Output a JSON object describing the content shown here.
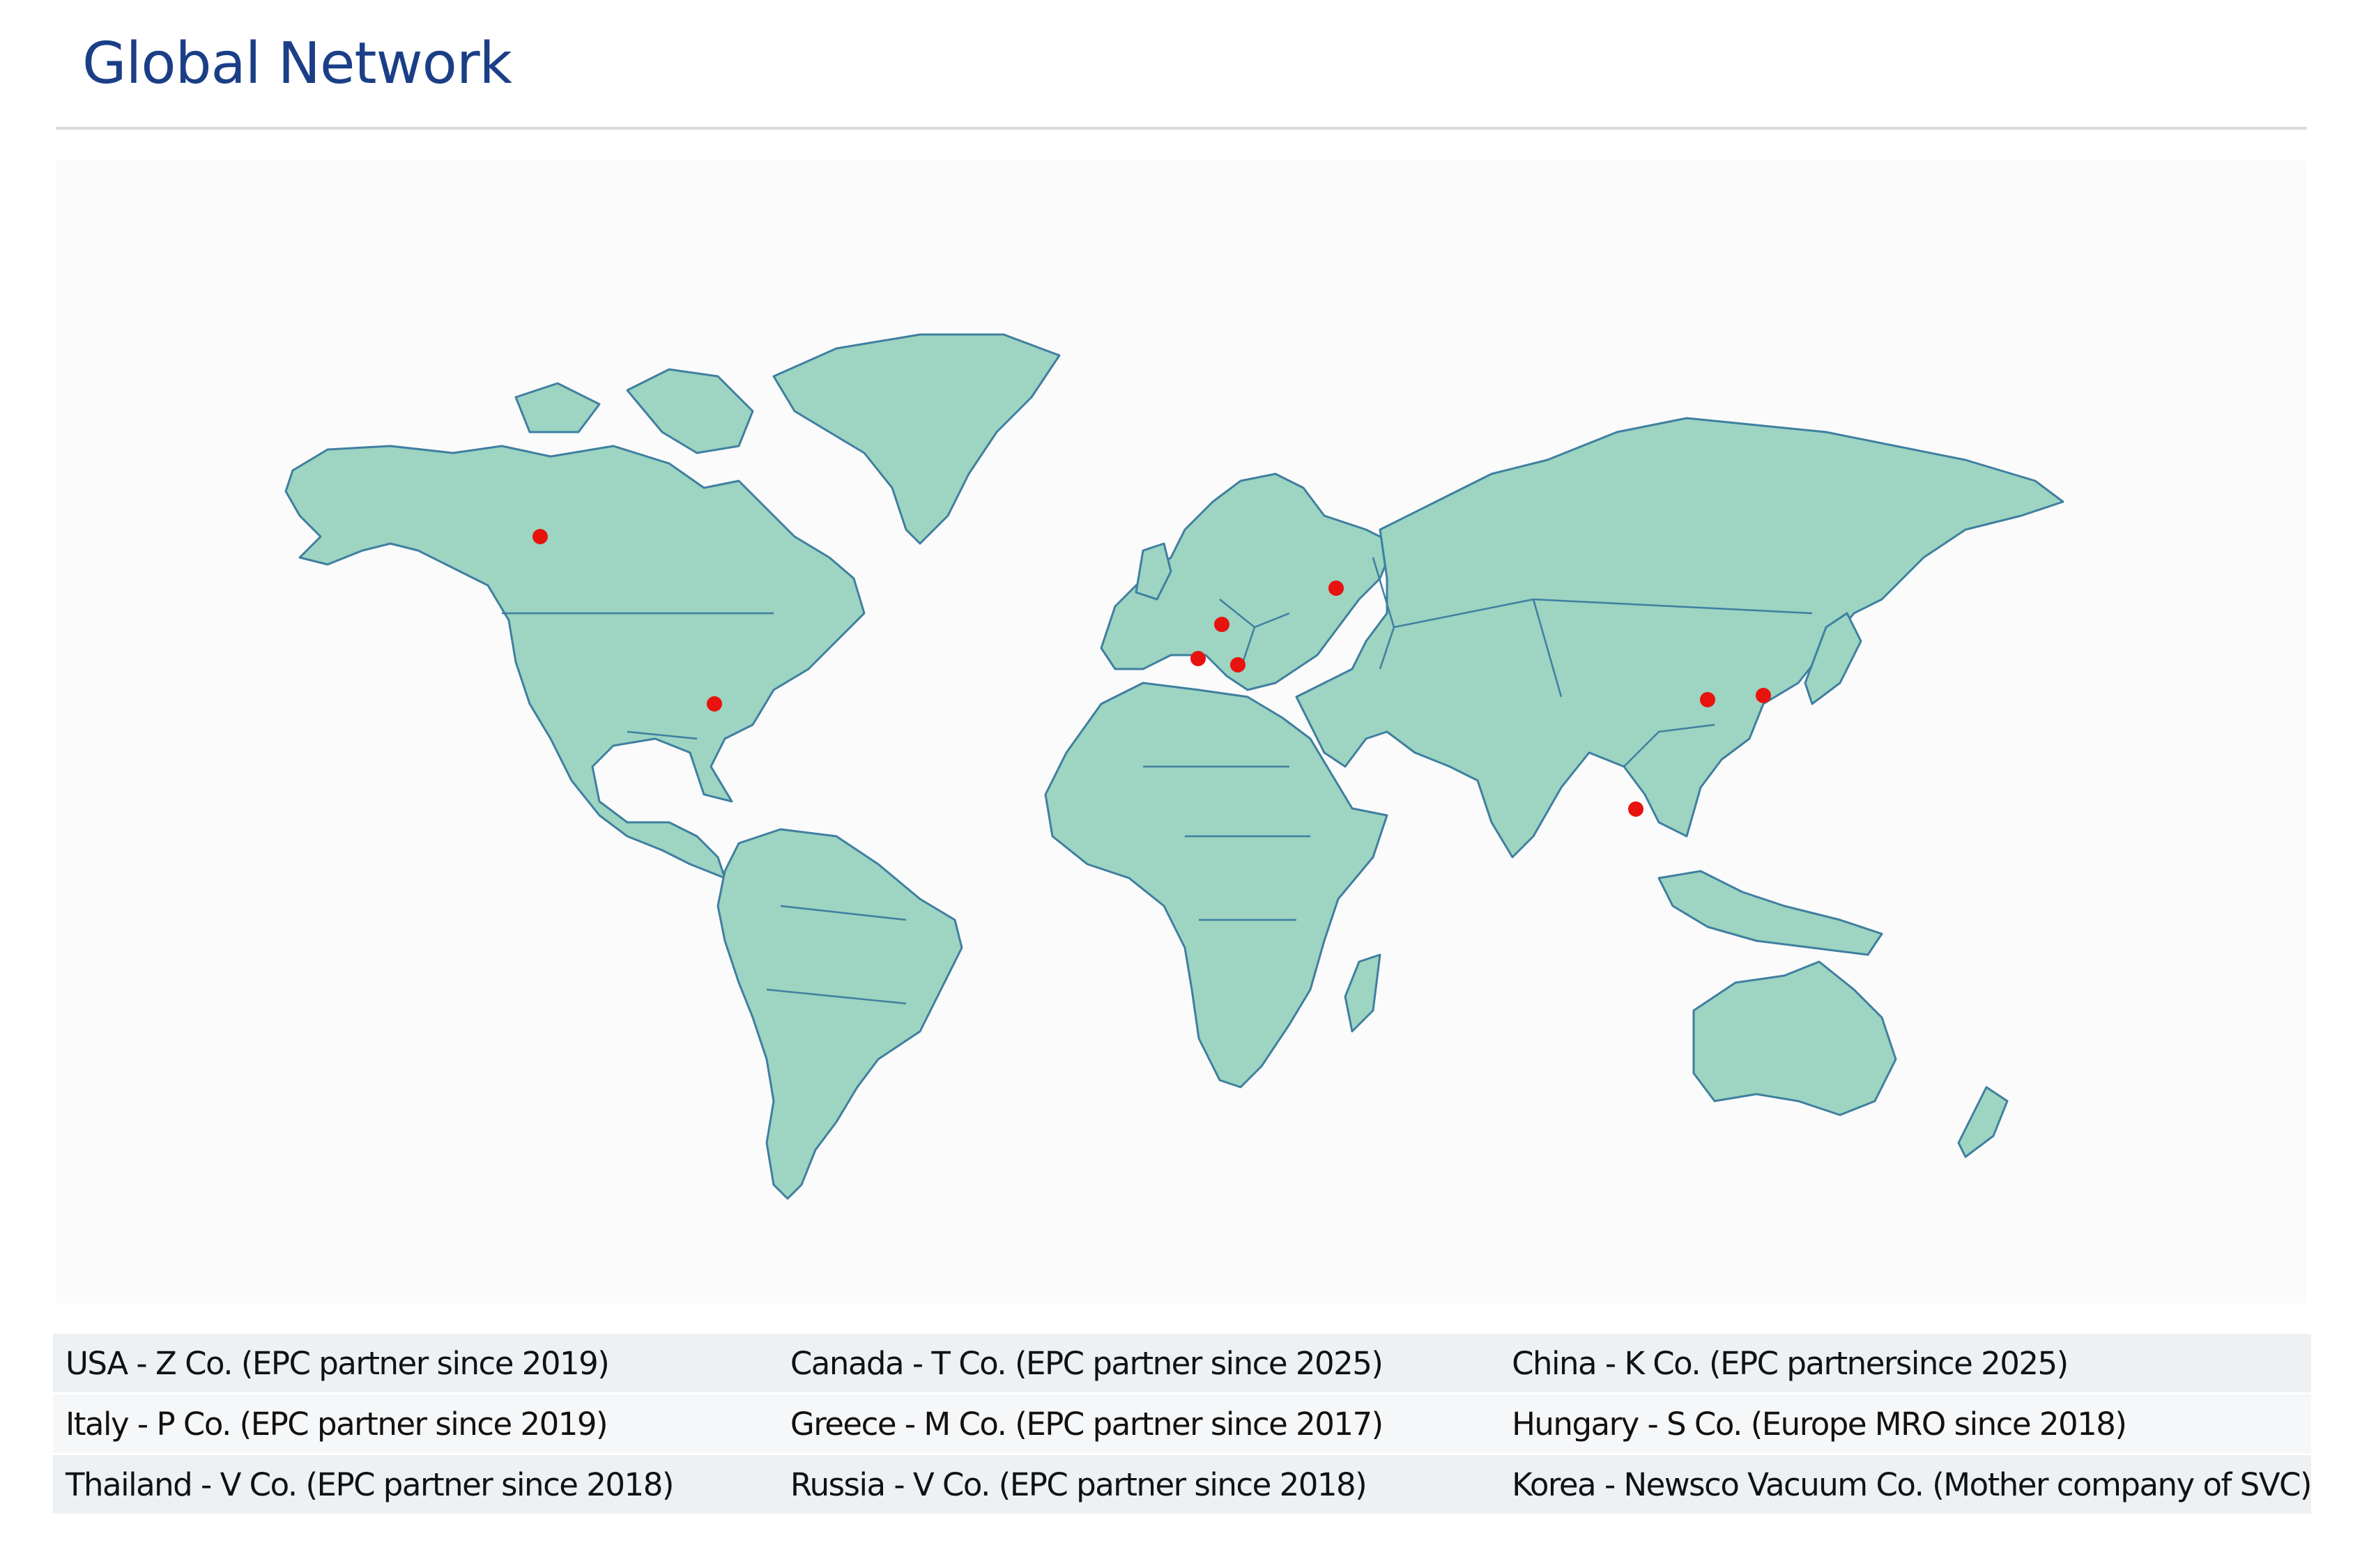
{
  "header": {
    "title": "Global Network"
  },
  "map": {
    "land_color": "#9dd4c2",
    "border_color": "#3f7fa0",
    "marker_color": "#e8120f",
    "markers": [
      {
        "country": "Canada"
      },
      {
        "country": "USA"
      },
      {
        "country": "Hungary"
      },
      {
        "country": "Italy"
      },
      {
        "country": "Greece"
      },
      {
        "country": "Russia"
      },
      {
        "country": "China"
      },
      {
        "country": "Korea"
      },
      {
        "country": "Thailand"
      }
    ]
  },
  "partners": {
    "rows": [
      [
        "USA - Z Co.  (EPC partner since 2019)",
        "Canada - T Co.  (EPC partner since 2025)",
        "China - K  Co.  (EPC partnersince 2025)"
      ],
      [
        "Italy - P Co.  (EPC partner since 2019)",
        "Greece - M Co.  (EPC partner since 2017)",
        "Hungary - S Co.  (Europe MRO since 2018)"
      ],
      [
        "Thailand - V Co.  (EPC partner since 2018)",
        "Russia - V Co.  (EPC partner since 2018)",
        "Korea - Newsco Vacuum Co. (Mother company of SVC)"
      ]
    ]
  }
}
